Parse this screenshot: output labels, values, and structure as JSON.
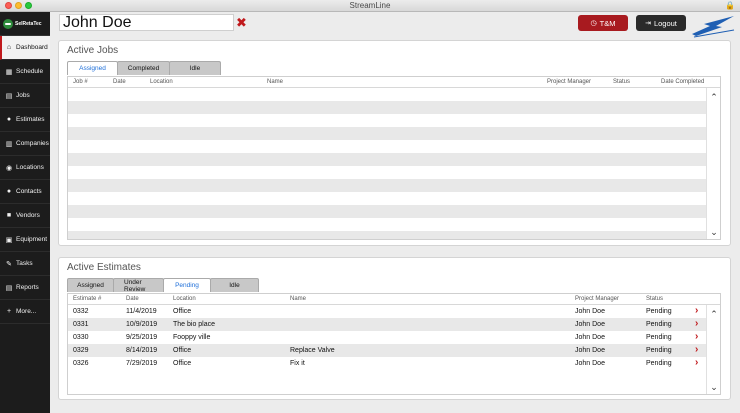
{
  "window": {
    "title": "StreamLine"
  },
  "sidebar": {
    "brand": "SelRetaTec",
    "items": [
      {
        "label": "Dashboard",
        "icon": "home-icon",
        "glyph": "⌂"
      },
      {
        "label": "Schedule",
        "icon": "calendar-icon",
        "glyph": "▦"
      },
      {
        "label": "Jobs",
        "icon": "jobs-icon",
        "glyph": "▤"
      },
      {
        "label": "Estimates",
        "icon": "chat-bubble-icon",
        "glyph": "●"
      },
      {
        "label": "Companies",
        "icon": "buildings-icon",
        "glyph": "▥"
      },
      {
        "label": "Locations",
        "icon": "map-pin-icon",
        "glyph": "◉"
      },
      {
        "label": "Contacts",
        "icon": "person-icon",
        "glyph": "●"
      },
      {
        "label": "Vendors",
        "icon": "truck-icon",
        "glyph": "■"
      },
      {
        "label": "Equipment",
        "icon": "equipment-icon",
        "glyph": "▣"
      },
      {
        "label": "Tasks",
        "icon": "edit-icon",
        "glyph": "✎"
      },
      {
        "label": "Reports",
        "icon": "report-icon",
        "glyph": "▤"
      },
      {
        "label": "More...",
        "icon": "plus-icon",
        "glyph": "+"
      }
    ]
  },
  "header": {
    "user_name": "John Doe",
    "tm_label": "T&M",
    "logout_label": "Logout"
  },
  "active_jobs": {
    "title": "Active Jobs",
    "tabs": [
      "Assigned",
      "Completed",
      "Idle"
    ],
    "columns": [
      "Job #",
      "Date",
      "Location",
      "Name",
      "Project Manager",
      "Status",
      "Date Completed"
    ],
    "rows": []
  },
  "active_estimates": {
    "title": "Active Estimates",
    "tabs": [
      "Assigned",
      "Under Review",
      "Pending",
      "Idle"
    ],
    "columns": [
      "Estimate #",
      "Date",
      "Location",
      "Name",
      "Project Manager",
      "Status"
    ],
    "rows": [
      {
        "number": "0332",
        "date": "11/4/2019",
        "location": "Office",
        "name": "",
        "manager": "John Doe",
        "status": "Pending"
      },
      {
        "number": "0331",
        "date": "10/9/2019",
        "location": "The bio place",
        "name": "",
        "manager": "John Doe",
        "status": "Pending"
      },
      {
        "number": "0330",
        "date": "9/25/2019",
        "location": "Fooppy ville",
        "name": "",
        "manager": "John Doe",
        "status": "Pending"
      },
      {
        "number": "0329",
        "date": "8/14/2019",
        "location": "Office",
        "name": "Replace Valve",
        "manager": "John Doe",
        "status": "Pending"
      },
      {
        "number": "0326",
        "date": "7/29/2019",
        "location": "Office",
        "name": "Fix it",
        "manager": "John Doe",
        "status": "Pending"
      }
    ]
  },
  "colors": {
    "accent": "#c0191c",
    "tab_active_text": "#1e6fd9",
    "sidebar_bg": "#1c1c1c"
  }
}
